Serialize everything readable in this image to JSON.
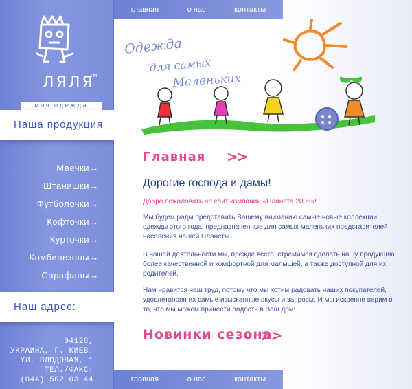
{
  "top_nav": [
    "главная",
    "о нас",
    "контакты"
  ],
  "bottom_nav": [
    "главная",
    "о нас",
    "контакты"
  ],
  "logo": {
    "brand": "ЛЯЛЯ",
    "trademark": "TM",
    "tagline": "моя одежда"
  },
  "sidebar": {
    "products_title": "Наша продукция",
    "menu": [
      {
        "label": "Маечки",
        "arrow": "→"
      },
      {
        "label": "Штанишки",
        "arrow": "→"
      },
      {
        "label": "Футболочки",
        "arrow": "→"
      },
      {
        "label": "Кофточки",
        "arrow": "→"
      },
      {
        "label": "Курточки",
        "arrow": "→"
      },
      {
        "label": "Комбинезоны",
        "arrow": "→"
      },
      {
        "label": "Сарафаны",
        "arrow": "→"
      }
    ],
    "address_title": "Наш адрес:",
    "address_lines": [
      "04128,",
      "УКРАИНА, Г. КИЕВ.",
      "УЛ. ПЛОДОВАЯ, 1",
      "ТЕЛ./ФАКС:",
      "(044) 502 03 44"
    ]
  },
  "banner": {
    "line1": "Одежда",
    "line2": "для самых",
    "line3": "Маленьких"
  },
  "content": {
    "page_heading": "Главная",
    "page_heading_arrow": ">>",
    "greeting": "Дорогие господа и дамы!",
    "welcome": "Добро пожаловать на сайт компании «Планета 2006»!",
    "paragraphs": [
      "Мы будем рады представить Вашему вниманию самые новые коллекции одежды этого года, предназначенные для самых маленьких представителей населения нашей Планеты.",
      "В нашей деятельности мы, прежде всего, стремимся сделать нашу продукцию более качественной и комфортной для малышей, а также доступной для их родителей.",
      "Нам нравится наш труд, потому что мы хотим радовать наших покупателей, удовлетворяя их самые изысканные вкусы и запросы. И мы искренне верим в то, что мы можем принести радость в Ваш дом!"
    ],
    "new_heading": "Новинки сезона",
    "new_heading_arrow": ">>"
  },
  "colors": {
    "sidebar": "#7c8fdc",
    "accent_pink": "#e34a8e",
    "text_blue": "#3d4fa0"
  }
}
